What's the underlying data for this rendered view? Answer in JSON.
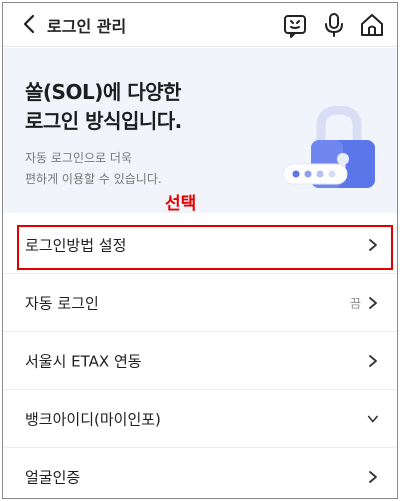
{
  "header": {
    "title": "로그인 관리"
  },
  "hero": {
    "title_line1": "쏠(SOL)에 다양한",
    "title_line2": "로그인 방식입니다.",
    "sub_line1": "자동 로그인으로 더욱",
    "sub_line2": "편하게 이용할 수 있습니다."
  },
  "annotation": {
    "select_label": "선택",
    "color": "#e00000"
  },
  "menu": {
    "items": [
      {
        "label": "로그인방법 설정",
        "trailing": "chevron-right-icon"
      },
      {
        "label": "자동 로그인",
        "status": "끔",
        "trailing": "chevron-right-icon"
      },
      {
        "label": "서울시 ETAX 연동",
        "trailing": "chevron-right-icon"
      },
      {
        "label": "뱅크아이디(마이인포)",
        "trailing": "chevron-down-icon"
      },
      {
        "label": "얼굴인증",
        "trailing": "chevron-right-icon"
      }
    ]
  },
  "colors": {
    "accent": "#5b76e8",
    "hero_bg": "#f1f4fb"
  }
}
